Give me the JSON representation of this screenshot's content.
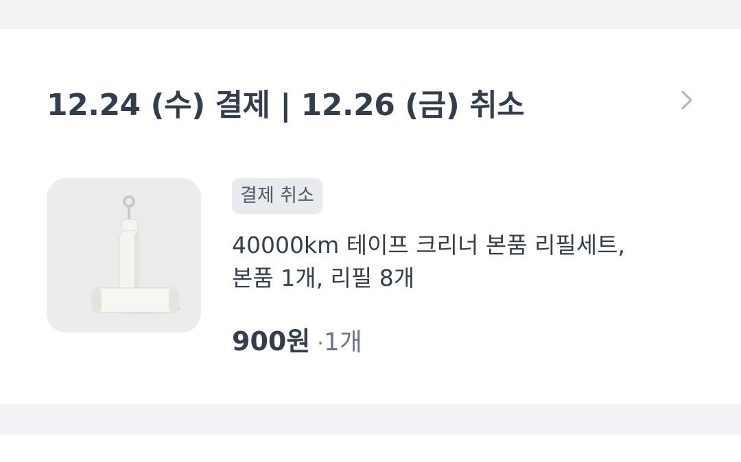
{
  "order": {
    "date_text": "12.24 (수) 결제 | 12.26 (금) 취소",
    "chevron_icon": "chevron-right-icon"
  },
  "item": {
    "image_icon": "lint-roller-product-image",
    "badge": "결제 취소",
    "name_line1": "40000km 테이프 크리너 본품 리필세트,",
    "name_line2": "본품 1개, 리필 8개",
    "price": "900원",
    "qty_separator": "·",
    "quantity": "1개"
  },
  "colors": {
    "text_primary": "#333d4b",
    "text_secondary": "#6b7684",
    "badge_bg": "#e8eaed",
    "divider_bg": "#f2f3f5",
    "chevron": "#b0b8c1"
  }
}
